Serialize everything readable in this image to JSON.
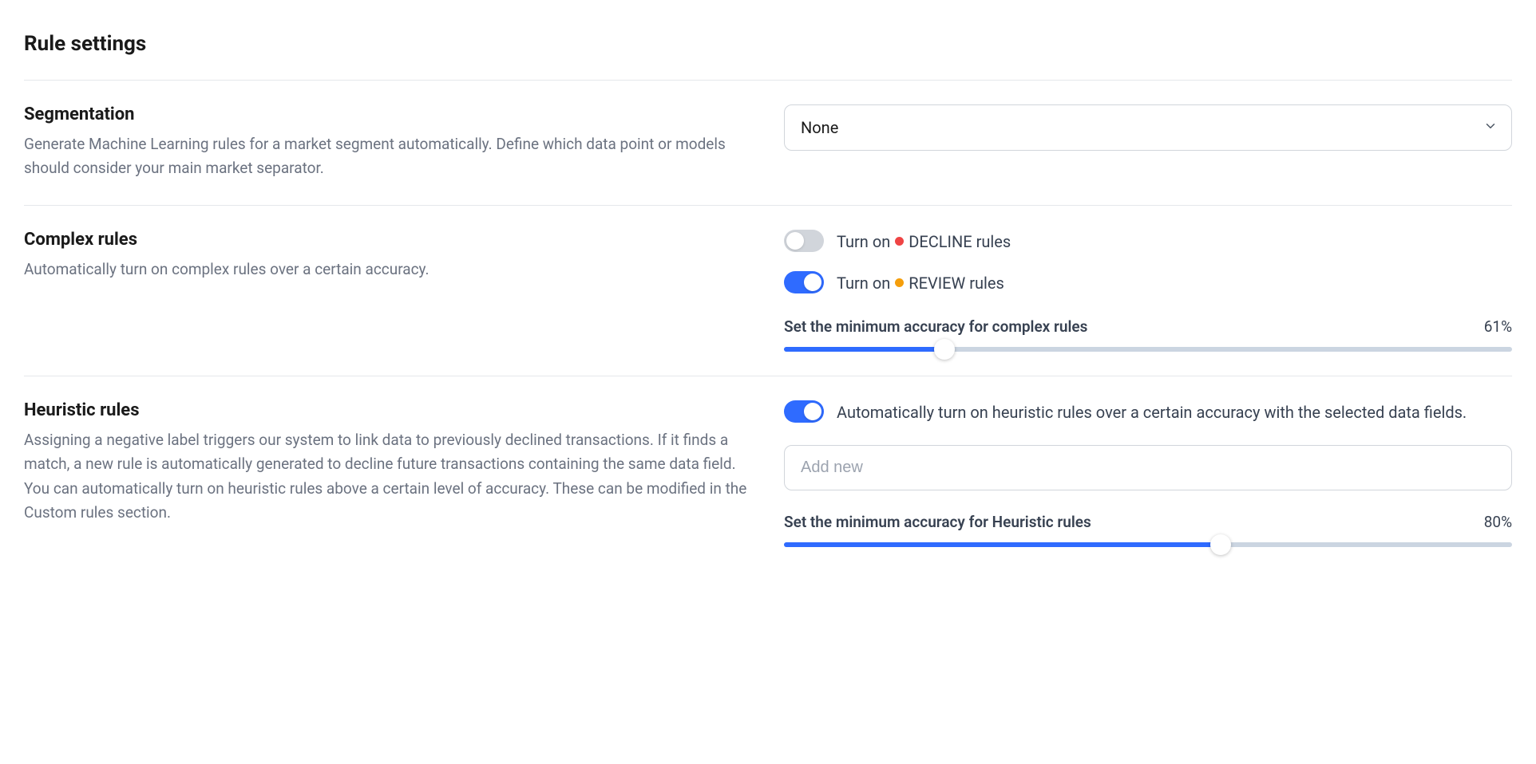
{
  "page": {
    "title": "Rule settings"
  },
  "segmentation": {
    "heading": "Segmentation",
    "description": "Generate Machine Learning rules for a market segment automatically. Define which data point or models should consider your main market separator.",
    "select_value": "None"
  },
  "complex_rules": {
    "heading": "Complex rules",
    "description": "Automatically turn on complex rules over a certain accuracy.",
    "decline": {
      "prefix": "Turn on",
      "label": "DECLINE rules",
      "enabled": false,
      "dot_color": "#ef4444"
    },
    "review": {
      "prefix": "Turn on",
      "label": "REVIEW rules",
      "enabled": true,
      "dot_color": "#f59e0b"
    },
    "slider": {
      "title": "Set the minimum accuracy for complex rules",
      "value": 61,
      "display": "61%"
    }
  },
  "heuristic_rules": {
    "heading": "Heuristic rules",
    "description": "Assigning a negative label triggers our system to link data to previously declined transactions. If it finds a match, a new rule is automatically generated to decline future transactions containing the same data field. You can automatically turn on heuristic rules above a certain level of accuracy. These can be modified in the Custom rules section.",
    "auto_toggle": {
      "label": "Automatically turn on heuristic rules over a certain accuracy with the selected data fields.",
      "enabled": true
    },
    "input": {
      "placeholder": "Add new",
      "value": ""
    },
    "slider": {
      "title": "Set the minimum accuracy for Heuristic rules",
      "value": 80,
      "display": "80%"
    }
  }
}
